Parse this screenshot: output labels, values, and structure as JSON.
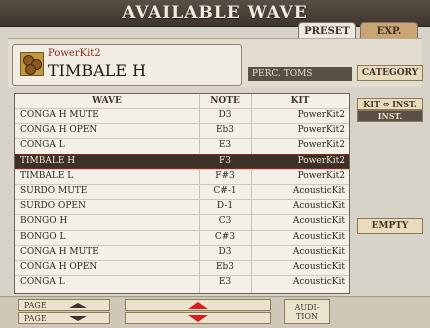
{
  "header": {
    "title": "AVAILABLE WAVE",
    "tabs": [
      {
        "label": "PRESET",
        "active": true
      },
      {
        "label": "EXP.",
        "active": false
      }
    ]
  },
  "voice": {
    "kit_name": "PowerKit2",
    "wave_name": "TIMBALE H",
    "category_filter": "PERC. TOMS",
    "icon": "drum-kit-icon"
  },
  "side": {
    "category_label": "CATEGORY",
    "kit_inst_label": "KIT ⇔ INST.",
    "inst_label": "INST.",
    "empty_label": "EMPTY"
  },
  "table": {
    "columns": [
      "WAVE",
      "NOTE",
      "KIT"
    ],
    "rows": [
      {
        "wave": "CONGA H MUTE",
        "note": "D3",
        "kit": "PowerKit2"
      },
      {
        "wave": "CONGA H OPEN",
        "note": "Eb3",
        "kit": "PowerKit2"
      },
      {
        "wave": "CONGA L",
        "note": "E3",
        "kit": "PowerKit2"
      },
      {
        "wave": "TIMBALE H",
        "note": "F3",
        "kit": "PowerKit2",
        "selected": true
      },
      {
        "wave": "TIMBALE L",
        "note": "F#3",
        "kit": "PowerKit2"
      },
      {
        "wave": "SURDO MUTE",
        "note": "C#-1",
        "kit": "AcousticKit"
      },
      {
        "wave": "SURDO OPEN",
        "note": "D-1",
        "kit": "AcousticKit"
      },
      {
        "wave": "BONGO H",
        "note": "C3",
        "kit": "AcousticKit"
      },
      {
        "wave": "BONGO L",
        "note": "C#3",
        "kit": "AcousticKit"
      },
      {
        "wave": "CONGA H MUTE",
        "note": "D3",
        "kit": "AcousticKit"
      },
      {
        "wave": "CONGA H OPEN",
        "note": "Eb3",
        "kit": "AcousticKit"
      },
      {
        "wave": "CONGA L",
        "note": "E3",
        "kit": "AcousticKit"
      }
    ]
  },
  "footer": {
    "page_label": "PAGE",
    "audition_line1": "AUDI-",
    "audition_line2": "TION"
  },
  "colors": {
    "accent_red": "#d51f1f",
    "selected_row_bg": "#3d3026",
    "title_bar": "#4a3f33"
  }
}
